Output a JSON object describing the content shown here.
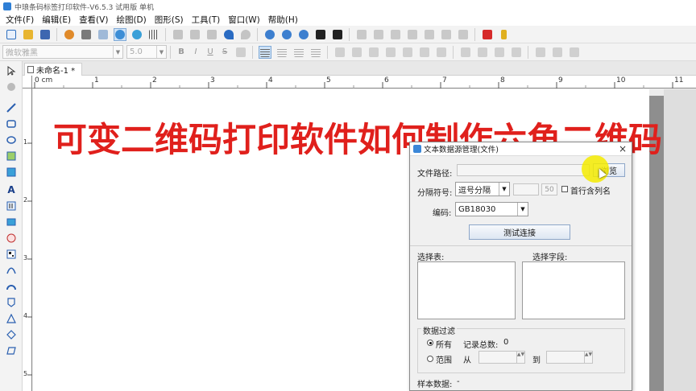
{
  "window": {
    "title": "中琅条码标签打印软件-V6.5.3 试用版 单机"
  },
  "menu": [
    "文件(F)",
    "编辑(E)",
    "查看(V)",
    "绘图(D)",
    "图形(S)",
    "工具(T)",
    "窗口(W)",
    "帮助(H)"
  ],
  "format_bar": {
    "font_name": "微软雅黑",
    "font_size": "5.0",
    "bold": "B",
    "italic": "I",
    "underline": "U",
    "strike": "S"
  },
  "tab": {
    "label": "未命名-1 *"
  },
  "ruler": {
    "unit": "0 cm",
    "h_ticks": [
      "1",
      "2",
      "3",
      "4",
      "5",
      "6",
      "7",
      "8",
      "9",
      "10",
      "11"
    ],
    "v_ticks": [
      "1",
      "2",
      "3",
      "4",
      "5"
    ]
  },
  "headline": "可变二维码打印软件如何制作六角二维码",
  "dialog": {
    "title": "文本数据源管理(文件)",
    "close": "×",
    "file_path_label": "文件路径:",
    "file_path_value": "",
    "browse_button": "浏览",
    "separator_label": "分隔符号:",
    "separator_value": "逗号分隔",
    "separator_count": "50",
    "first_row_label": "首行含列名",
    "encoding_label": "编码:",
    "encoding_value": "GB18030",
    "test_button": "测试连接",
    "select_table_label": "选择表:",
    "select_field_label": "选择字段:",
    "filter_group": "数据过滤",
    "all_label": "所有",
    "record_count_label": "记录总数:",
    "record_count_value": "0",
    "range_label": "范围",
    "from_label": "从",
    "to_label": "到",
    "sample_label": "样本数据:",
    "sample_value": "-"
  },
  "colors": {
    "headline": "#e0201c",
    "highlight": "#f5eb00",
    "accent": "#2e7fd6"
  }
}
